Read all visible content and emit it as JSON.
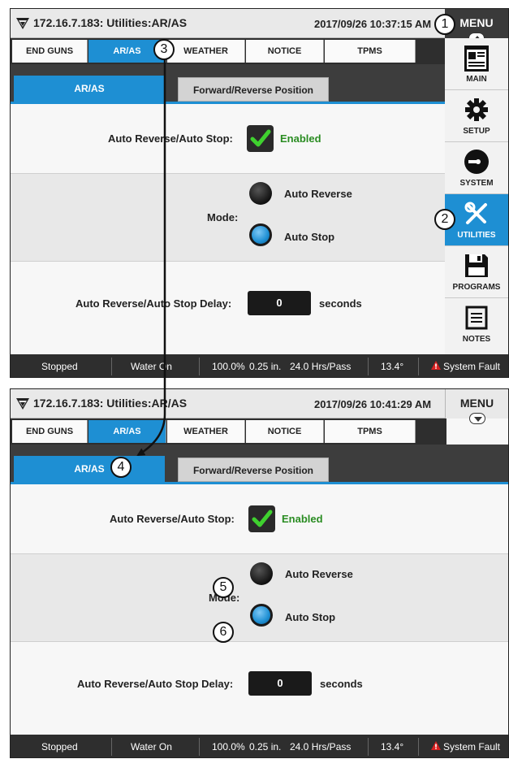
{
  "screen1": {
    "title": "172.16.7.183: Utilities:AR/AS",
    "datetime": "2017/09/26 10:37:15 AM",
    "menu_label": "MENU",
    "tabs": [
      "END GUNS",
      "AR/AS",
      "WEATHER",
      "NOTICE",
      "TPMS"
    ],
    "subtabs": [
      "AR/AS",
      "Forward/Reverse Position"
    ],
    "aras_label": "Auto Reverse/Auto Stop:",
    "enabled_label": "Enabled",
    "mode_label": "Mode:",
    "auto_reverse_label": "Auto Reverse",
    "auto_stop_label": "Auto Stop",
    "delay_label": "Auto Reverse/Auto Stop Delay:",
    "delay_value": "0",
    "seconds_label": "seconds",
    "status": [
      "Stopped",
      "Water On",
      "100.0%",
      "0.25 in.",
      "24.0 Hrs/Pass",
      "13.4°",
      "System Fault"
    ],
    "side_menu": [
      "MAIN",
      "SETUP",
      "SYSTEM",
      "UTILITIES",
      "PROGRAMS",
      "NOTES"
    ]
  },
  "screen2": {
    "title": "172.16.7.183: Utilities:AR/AS",
    "datetime": "2017/09/26 10:41:29 AM",
    "menu_label": "MENU",
    "tabs": [
      "END GUNS",
      "AR/AS",
      "WEATHER",
      "NOTICE",
      "TPMS"
    ],
    "subtabs": [
      "AR/AS",
      "Forward/Reverse Position"
    ],
    "aras_label": "Auto Reverse/Auto Stop:",
    "enabled_label": "Enabled",
    "mode_label": "Mode:",
    "auto_reverse_label": "Auto Reverse",
    "auto_stop_label": "Auto Stop",
    "delay_label": "Auto Reverse/Auto Stop Delay:",
    "delay_value": "0",
    "seconds_label": "seconds",
    "status": [
      "Stopped",
      "Water On",
      "100.0%",
      "0.25 in.",
      "24.0 Hrs/Pass",
      "13.4°",
      "System Fault"
    ]
  },
  "callouts": [
    "1",
    "2",
    "3",
    "4",
    "5",
    "6"
  ],
  "colors": {
    "accent": "#1e8fd3",
    "enabled_green": "#2a8c22",
    "fault_red": "#d92121",
    "dark_bar": "#2e2e2e"
  }
}
